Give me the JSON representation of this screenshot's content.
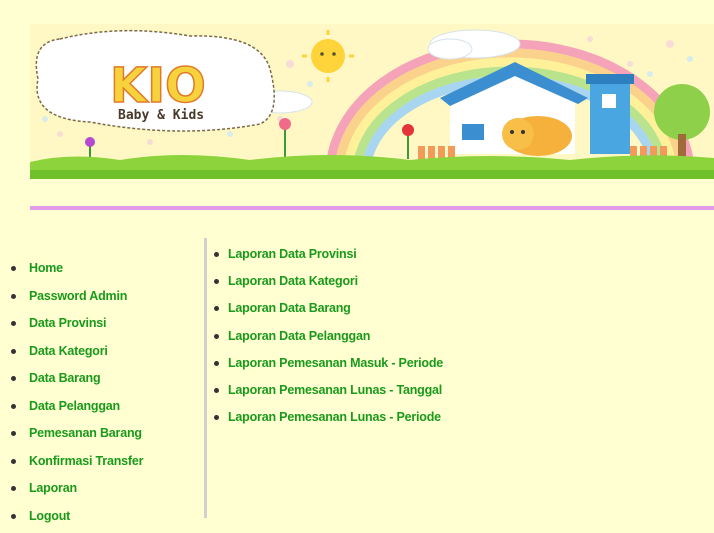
{
  "banner": {
    "logo_title": "KIO",
    "logo_subtitle": "Baby & Kids"
  },
  "sidebar": {
    "items": [
      {
        "label": "Home"
      },
      {
        "label": "Password Admin"
      },
      {
        "label": "Data Provinsi"
      },
      {
        "label": "Data Kategori"
      },
      {
        "label": "Data Barang"
      },
      {
        "label": "Data Pelanggan"
      },
      {
        "label": "Pemesanan Barang"
      },
      {
        "label": "Konfirmasi Transfer"
      },
      {
        "label": "Laporan"
      },
      {
        "label": "Logout"
      }
    ]
  },
  "reports": {
    "items": [
      {
        "label": "Laporan Data Provinsi"
      },
      {
        "label": "Laporan Data Kategori"
      },
      {
        "label": "Laporan Data Barang"
      },
      {
        "label": "Laporan Data Pelanggan"
      },
      {
        "label": "Laporan Pemesanan Masuk - Periode"
      },
      {
        "label": "Laporan Pemesanan Lunas - Tanggal"
      },
      {
        "label": "Laporan Pemesanan Lunas - Periode"
      }
    ]
  },
  "colors": {
    "background": "#ffffd2",
    "link": "#1a9a1a",
    "divider": "#e59ae8",
    "banner_sky": "#fff6b5",
    "grass": "#8dd33c"
  }
}
